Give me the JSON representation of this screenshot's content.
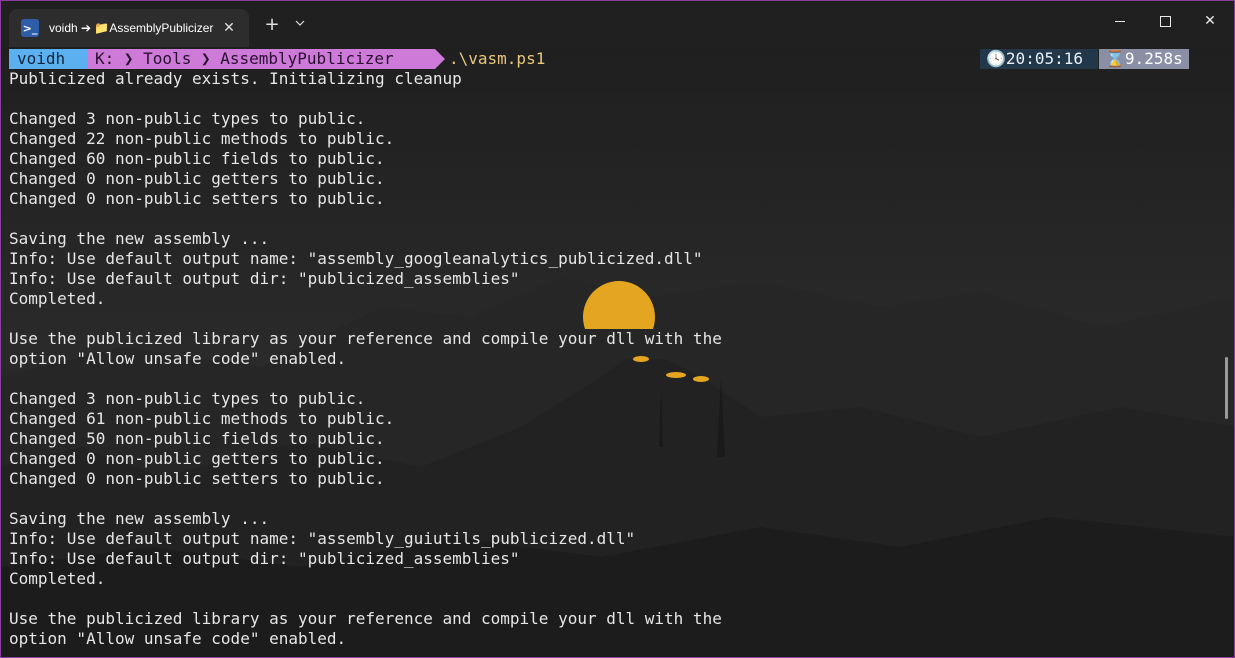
{
  "window": {
    "tab_title": "voidh ➔ 📁AssemblyPublicizer",
    "tab_icon": "powershell-icon",
    "close_tab": "✕",
    "new_tab": "+",
    "dropdown": "⌄",
    "controls": {
      "minimize": "minimize-icon",
      "maximize": "maximize-icon",
      "close": "✕"
    }
  },
  "prompt": {
    "user": "voidh",
    "path": "K:  ❯  Tools  ❯  AssemblyPublicizer",
    "command": ".\\vasm.ps1",
    "clock": "🕓20:05:16",
    "duration": "⌛9.258s"
  },
  "output": [
    "Publicized already exists. Initializing cleanup",
    "",
    "Changed 3 non-public types to public.",
    "Changed 22 non-public methods to public.",
    "Changed 60 non-public fields to public.",
    "Changed 0 non-public getters to public.",
    "Changed 0 non-public setters to public.",
    "",
    "Saving the new assembly ...",
    "Info: Use default output name: \"assembly_googleanalytics_publicized.dll\"",
    "Info: Use default output dir: \"publicized_assemblies\"",
    "Completed.",
    "",
    "Use the publicized library as your reference and compile your dll with the",
    "option \"Allow unsafe code\" enabled.",
    "",
    "Changed 3 non-public types to public.",
    "Changed 61 non-public methods to public.",
    "Changed 50 non-public fields to public.",
    "Changed 0 non-public getters to public.",
    "Changed 0 non-public setters to public.",
    "",
    "Saving the new assembly ...",
    "Info: Use default output name: \"assembly_guiutils_publicized.dll\"",
    "Info: Use default output dir: \"publicized_assemblies\"",
    "Completed.",
    "",
    "Use the publicized library as your reference and compile your dll with the",
    "option \"Allow unsafe code\" enabled."
  ],
  "colors": {
    "user_segment": "#5bb1f0",
    "path_segment": "#cd7ad8",
    "command": "#e9c77a",
    "sun": "#e4a520",
    "window_border": "#8a3fa0"
  }
}
